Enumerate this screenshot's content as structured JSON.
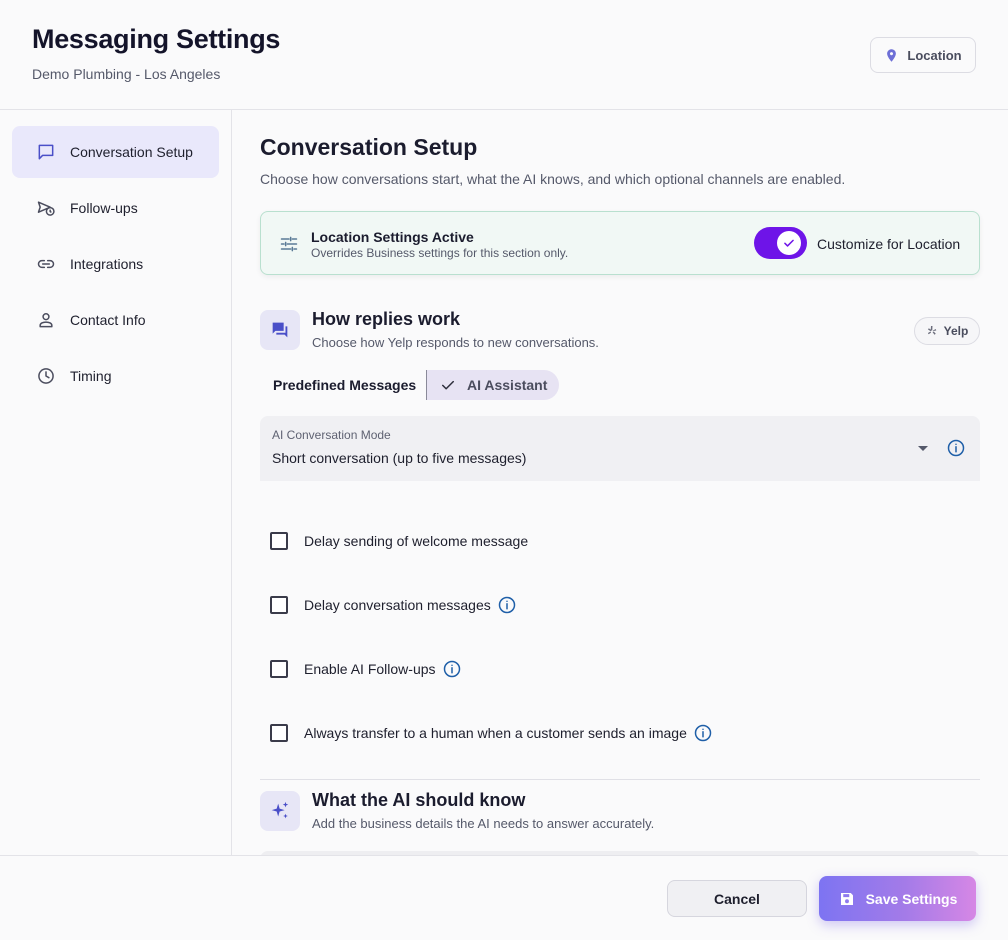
{
  "header": {
    "title": "Messaging Settings",
    "subtitle": "Demo Plumbing - Los Angeles",
    "location_button": "Location"
  },
  "sidebar": {
    "items": [
      {
        "label": "Conversation Setup",
        "icon": "chat-bubble-icon",
        "active": true
      },
      {
        "label": "Follow-ups",
        "icon": "send-clock-icon",
        "active": false
      },
      {
        "label": "Integrations",
        "icon": "link-icon",
        "active": false
      },
      {
        "label": "Contact Info",
        "icon": "person-icon",
        "active": false
      },
      {
        "label": "Timing",
        "icon": "clock-icon",
        "active": false
      }
    ]
  },
  "main": {
    "title": "Conversation Setup",
    "description": "Choose how conversations start, what the AI knows, and which optional channels are enabled.",
    "location_card": {
      "title": "Location Settings Active",
      "subtitle": "Overrides Business settings for this section only.",
      "toggle_label": "Customize for Location",
      "toggle_on": true
    },
    "replies": {
      "title": "How replies work",
      "subtitle": "Choose how Yelp responds to new conversations.",
      "chip": "Yelp",
      "segments": {
        "left": "Predefined Messages",
        "right": "AI Assistant",
        "selected": "AI Assistant"
      },
      "mode_select": {
        "label": "AI Conversation Mode",
        "value": "Short conversation (up to five messages)"
      },
      "checkboxes": [
        {
          "label": "Delay sending of welcome message",
          "checked": false,
          "info": false
        },
        {
          "label": "Delay conversation messages",
          "checked": false,
          "info": true
        },
        {
          "label": "Enable AI Follow-ups",
          "checked": false,
          "info": true
        },
        {
          "label": "Always transfer to a human when a customer sends an image",
          "checked": false,
          "info": true
        }
      ]
    },
    "knowledge": {
      "title": "What the AI should know",
      "subtitle": "Add the business details the AI needs to answer accurately."
    }
  },
  "footer": {
    "cancel_label": "Cancel",
    "save_label": "Save Settings"
  },
  "colors": {
    "accent": "#6e14e8",
    "info_blue": "#1f5fa8",
    "green_card_bg": "#f1f8f5",
    "green_card_border": "#b9e0cf"
  }
}
